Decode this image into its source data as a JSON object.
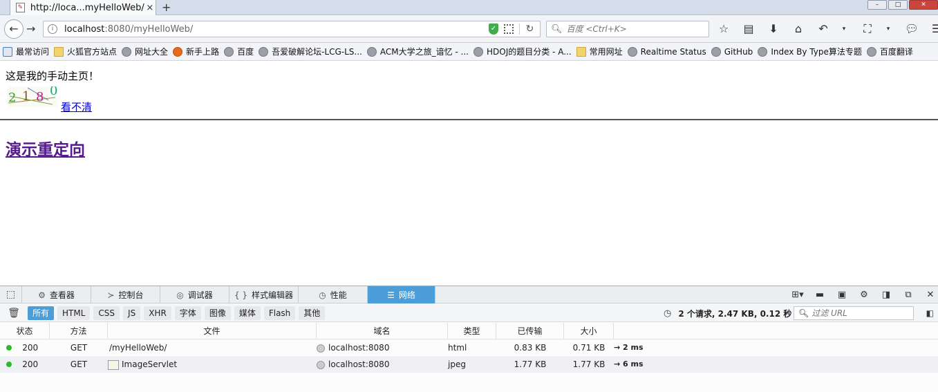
{
  "browser": {
    "tab_title": "http://loca...myHelloWeb/",
    "tab_close": "×",
    "new_tab": "+",
    "url_host": "localhost",
    "url_rest": ":8080/myHelloWeb/",
    "search_placeholder": "百度 <Ctrl+K>"
  },
  "bookmarks": [
    {
      "label": "最常访问",
      "icon": "search-icon"
    },
    {
      "label": "火狐官方站点",
      "icon": "folder-icon"
    },
    {
      "label": "网址大全",
      "icon": "globe-icon"
    },
    {
      "label": "新手上路",
      "icon": "firefox-icon"
    },
    {
      "label": "百度",
      "icon": "globe-icon"
    },
    {
      "label": "吾爱破解论坛-LCG-LS...",
      "icon": "globe-icon"
    },
    {
      "label": "ACM大学之旅_谙忆 - ...",
      "icon": "globe-icon"
    },
    {
      "label": "HDOJ的题目分类 - A...",
      "icon": "globe-icon"
    },
    {
      "label": "常用网址",
      "icon": "folder-icon"
    },
    {
      "label": "Realtime Status",
      "icon": "globe-icon"
    },
    {
      "label": "GitHub",
      "icon": "globe-icon"
    },
    {
      "label": "Index By Type算法专题",
      "icon": "globe-icon"
    },
    {
      "label": "百度翻译",
      "icon": "globe-icon"
    }
  ],
  "page": {
    "message": "这是我的手动主页！",
    "captcha_chars": [
      "2",
      "1",
      "8",
      "0"
    ],
    "captcha_colors": [
      "#2aa02a",
      "#7a5a2a",
      "#c0208a",
      "#1aa87a"
    ],
    "unclear_link": "看不清",
    "redirect_link": "演示重定向"
  },
  "devtools": {
    "tabs": [
      {
        "label": "查看器",
        "icon": "⚙"
      },
      {
        "label": "控制台",
        "icon": "≻"
      },
      {
        "label": "调试器",
        "icon": "◎"
      },
      {
        "label": "样式编辑器",
        "icon": "{ }"
      },
      {
        "label": "性能",
        "icon": "◷"
      },
      {
        "label": "网络",
        "icon": "☰"
      }
    ],
    "filters": [
      "所有",
      "HTML",
      "CSS",
      "JS",
      "XHR",
      "字体",
      "图像",
      "媒体",
      "Flash",
      "其他"
    ],
    "summary": "2 个请求, 2.47 KB, 0.12 秒",
    "filter_placeholder": "过滤 URL",
    "columns": [
      "状态",
      "方法",
      "文件",
      "域名",
      "类型",
      "已传输",
      "大小",
      ""
    ],
    "rows": [
      {
        "status": "200",
        "method": "GET",
        "file": "/myHelloWeb/",
        "domain": "localhost:8080",
        "type": "html",
        "transferred": "0.83 KB",
        "size": "0.71 KB",
        "time": "→ 2 ms"
      },
      {
        "status": "200",
        "method": "GET",
        "file": "ImageServlet",
        "domain": "localhost:8080",
        "type": "jpeg",
        "transferred": "1.77 KB",
        "size": "1.77 KB",
        "time": "→ 6 ms"
      }
    ],
    "status_color": "#2dbb2d",
    "accent": "#4c9ed9"
  }
}
